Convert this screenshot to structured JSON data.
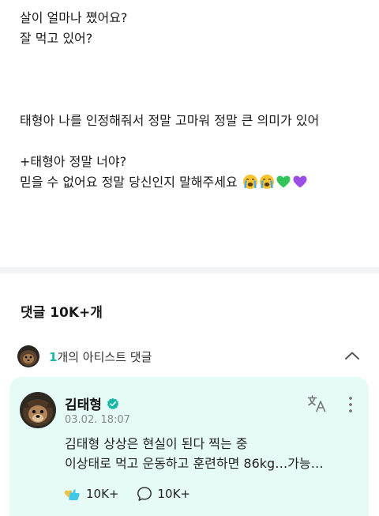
{
  "post": {
    "lines": [
      "살이 얼마나 쪘어요?",
      "잘 먹고 있어?",
      "",
      "",
      "",
      "태형아 나를 인정해줘서 정말 고마워 정말 큰 의미가 있어",
      "",
      "+태형아 정말 너야?",
      "믿을 수 없어요 정말 당신인지 말해주세요"
    ],
    "emojis": [
      "crying-face",
      "crying-face",
      "green-heart",
      "purple-heart"
    ]
  },
  "comments": {
    "count_label": "댓글 10K+개",
    "artist_row": {
      "count": "1",
      "label": "개의 아티스트 댓글"
    }
  },
  "comment": {
    "author": "김태형",
    "date": "03.02. 18:07",
    "body_lines": [
      "김태형 상상은 현실이 된다 찍는 중",
      "이상태로 먹고 운동하고 훈련하면 86kg…가능…"
    ],
    "likes": "10K+",
    "replies": "10K+"
  },
  "colors": {
    "accent": "#14b8a6",
    "card_bg": "#e6fbf6",
    "divider": "#f3f4f6"
  }
}
